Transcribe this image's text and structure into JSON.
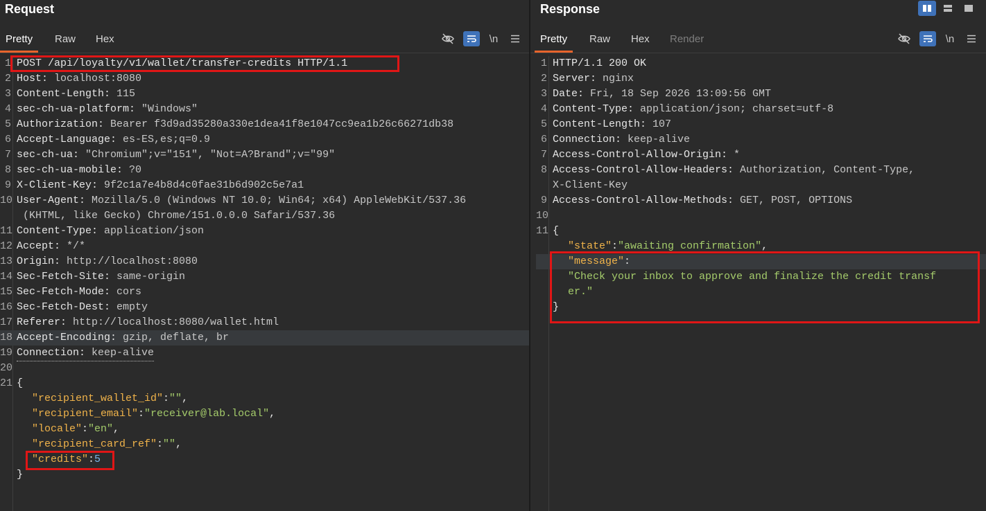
{
  "request": {
    "title": "Request",
    "tabs": [
      "Pretty",
      "Raw",
      "Hex"
    ],
    "active_tab": "Pretty",
    "toolbar_icons": [
      "eye-slash-icon",
      "wrap-lines-icon",
      "newline-icon",
      "menu-icon"
    ],
    "lines": [
      {
        "n": "1",
        "k": "POST /api/loyalty/v1/wallet/transfer-credits HTTP/1.1",
        "v": ""
      },
      {
        "n": "2",
        "k": "Host: ",
        "v": "localhost:8080"
      },
      {
        "n": "3",
        "k": "Content-Length: ",
        "v": "115"
      },
      {
        "n": "4",
        "k": "sec-ch-ua-platform: ",
        "v": "\"Windows\""
      },
      {
        "n": "5",
        "k": "Authorization: ",
        "v": "Bearer f3d9ad35280a330e1dea41f8e1047cc9ea1b26c66271db38"
      },
      {
        "n": "6",
        "k": "Accept-Language: ",
        "v": "es-ES,es;q=0.9"
      },
      {
        "n": "7",
        "k": "sec-ch-ua: ",
        "v": "\"Chromium\";v=\"151\", \"Not=A?Brand\";v=\"99\""
      },
      {
        "n": "8",
        "k": "sec-ch-ua-mobile: ",
        "v": "?0"
      },
      {
        "n": "9",
        "k": "X-Client-Key: ",
        "v": "9f2c1a7e4b8d4c0fae31b6d902c5e7a1"
      },
      {
        "n": "10",
        "k": "User-Agent: ",
        "v": "Mozilla/5.0 (Windows NT 10.0; Win64; x64) AppleWebKit/537.36"
      },
      {
        "n": "",
        "k": "",
        "v": " (KHTML, like Gecko) Chrome/151.0.0.0 Safari/537.36"
      },
      {
        "n": "11",
        "k": "Content-Type: ",
        "v": "application/json"
      },
      {
        "n": "12",
        "k": "Accept: ",
        "v": "*/*"
      },
      {
        "n": "13",
        "k": "Origin: ",
        "v": "http://localhost:8080"
      },
      {
        "n": "14",
        "k": "Sec-Fetch-Site: ",
        "v": "same-origin"
      },
      {
        "n": "15",
        "k": "Sec-Fetch-Mode: ",
        "v": "cors"
      },
      {
        "n": "16",
        "k": "Sec-Fetch-Dest: ",
        "v": "empty"
      },
      {
        "n": "17",
        "k": "Referer: ",
        "v": "http://localhost:8080/wallet.html"
      },
      {
        "n": "18",
        "k": "Accept-Encoding: ",
        "v": "gzip, deflate, br"
      },
      {
        "n": "19",
        "k": "Connection: ",
        "v": "keep-alive"
      },
      {
        "n": "20",
        "k": "",
        "v": ""
      },
      {
        "n": "21",
        "k": "{",
        "v": ""
      }
    ],
    "body": [
      {
        "key": "\"recipient_wallet_id\"",
        "val": "\"\"",
        "type": "string",
        "comma": ","
      },
      {
        "key": "\"recipient_email\"",
        "val": "\"receiver@lab.local\"",
        "type": "string",
        "comma": ","
      },
      {
        "key": "\"locale\"",
        "val": "\"en\"",
        "type": "string",
        "comma": ","
      },
      {
        "key": "\"recipient_card_ref\"",
        "val": "\"\"",
        "type": "string",
        "comma": ","
      },
      {
        "key": "\"credits\"",
        "val": "5",
        "type": "number",
        "comma": ""
      }
    ],
    "closing": "}"
  },
  "response": {
    "title": "Response",
    "tabs": [
      "Pretty",
      "Raw",
      "Hex",
      "Render"
    ],
    "active_tab": "Pretty",
    "toolbar_icons": [
      "eye-slash-icon",
      "wrap-lines-icon",
      "newline-icon",
      "menu-icon"
    ],
    "view_icons": [
      "split-horizontal-icon",
      "split-vertical-icon",
      "single-pane-icon"
    ],
    "lines": [
      {
        "n": "1",
        "k": "HTTP/1.1 200 OK",
        "v": ""
      },
      {
        "n": "2",
        "k": "Server: ",
        "v": "nginx"
      },
      {
        "n": "3",
        "k": "Date: ",
        "v": "Fri, 18 Sep 2026 13:09:56 GMT"
      },
      {
        "n": "4",
        "k": "Content-Type: ",
        "v": "application/json; charset=utf-8"
      },
      {
        "n": "5",
        "k": "Content-Length: ",
        "v": "107"
      },
      {
        "n": "6",
        "k": "Connection: ",
        "v": "keep-alive"
      },
      {
        "n": "7",
        "k": "Access-Control-Allow-Origin: ",
        "v": "*"
      },
      {
        "n": "8",
        "k": "Access-Control-Allow-Headers: ",
        "v": "Authorization, Content-Type,"
      },
      {
        "n": "",
        "k": "",
        "v": "X-Client-Key"
      },
      {
        "n": "9",
        "k": "Access-Control-Allow-Methods: ",
        "v": "GET, POST, OPTIONS"
      },
      {
        "n": "10",
        "k": "",
        "v": ""
      },
      {
        "n": "11",
        "k": "{",
        "v": ""
      }
    ],
    "body": {
      "state_key": "\"state\"",
      "state_val": "\"awaiting confirmation\"",
      "message_key": "\"message\"",
      "message_val_1": "\"Check your inbox to approve and finalize the credit transf",
      "message_val_2": "er.\"",
      "closing": "}"
    }
  },
  "colors": {
    "accent": "#e8642c",
    "highlight_box": "#e01616",
    "active_tool": "#3f72b9"
  }
}
